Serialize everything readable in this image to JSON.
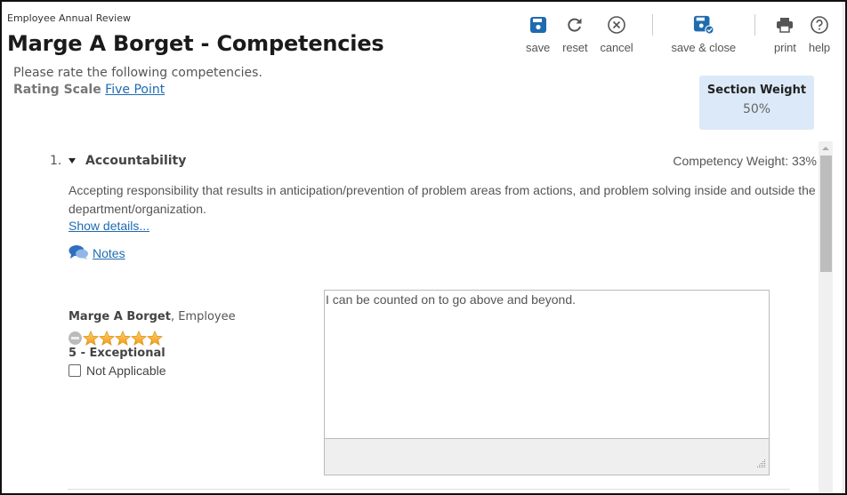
{
  "header": {
    "app_subtitle": "Employee Annual Review",
    "page_title": "Marge A Borget - Competencies",
    "instructions": "Please rate the following competencies.",
    "rating_scale_label": "Rating Scale",
    "rating_scale_value": "Five Point"
  },
  "toolbar": {
    "save": "save",
    "reset": "reset",
    "cancel": "cancel",
    "save_close": "save & close",
    "print": "print",
    "help": "help",
    "accent_color": "#1f6bb0"
  },
  "section_weight": {
    "title": "Section Weight",
    "value": "50%"
  },
  "competency": {
    "number": "1.",
    "title": "Accountability",
    "weight": "Competency Weight: 33%",
    "description": "Accepting responsibility that results in anticipation/prevention of problem areas from actions, and problem solving inside and outside the department/organization.",
    "show_details": "Show details...",
    "notes_label": "Notes",
    "rater": {
      "name": "Marge A Borget",
      "role": ", Employee",
      "rating": 5,
      "rating_max": 5,
      "rating_text": "5 - Exceptional",
      "not_applicable_label": "Not Applicable",
      "not_applicable_checked": false
    },
    "comment": "I can be counted on to go above and beyond."
  }
}
